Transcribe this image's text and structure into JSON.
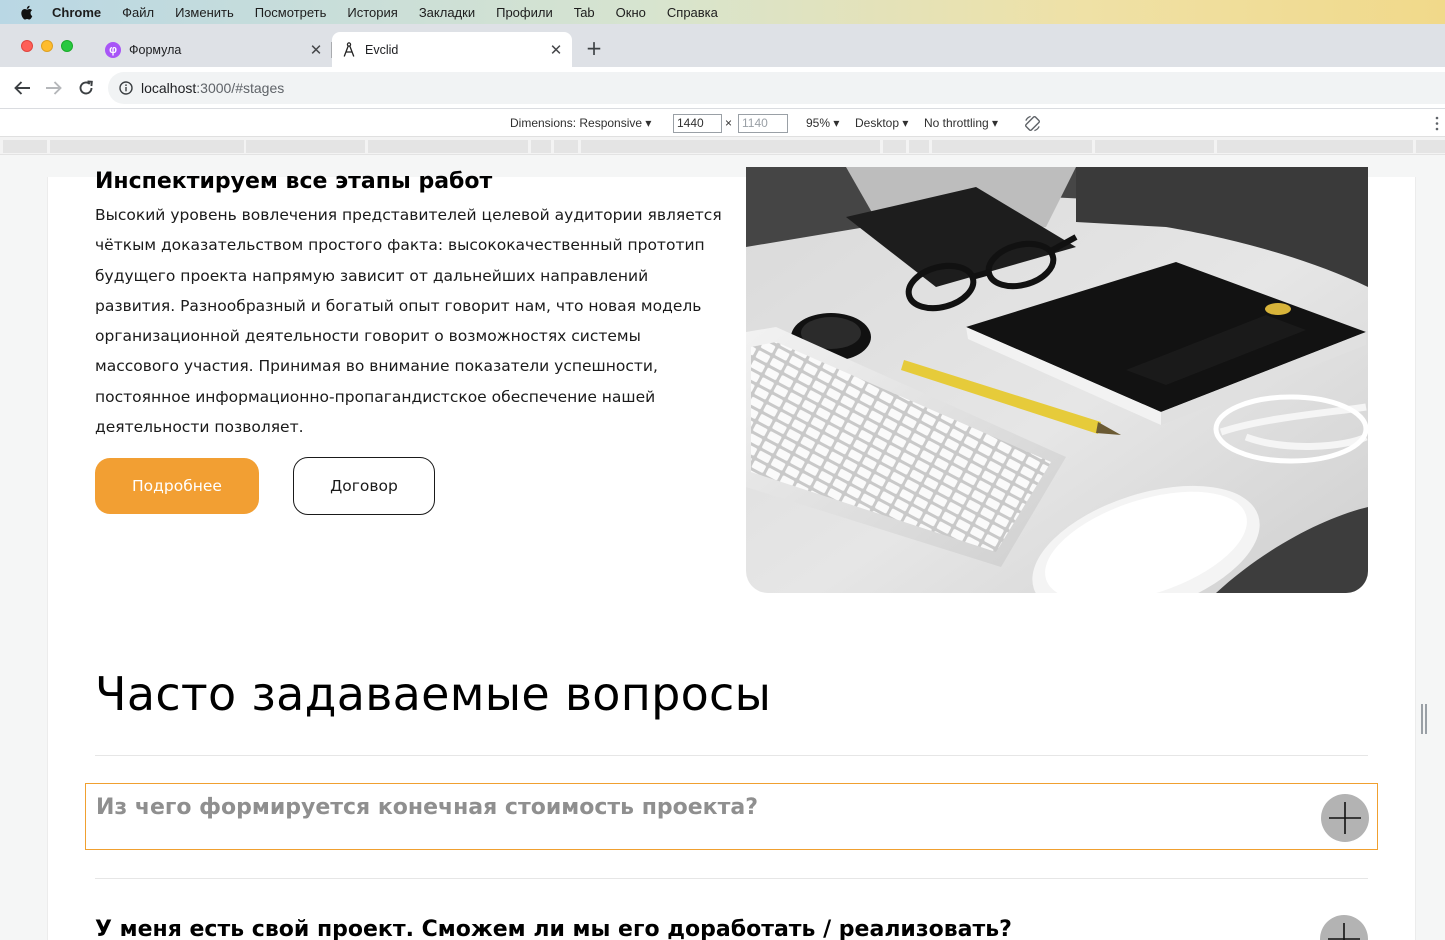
{
  "menubar": {
    "app_name": "Chrome",
    "items": [
      "Файл",
      "Изменить",
      "Посмотреть",
      "История",
      "Закладки",
      "Профили",
      "Tab",
      "Окно",
      "Справка"
    ]
  },
  "tabs": [
    {
      "title": "Формула",
      "favicon": "formula-favicon",
      "active": false,
      "favicon_glyph": "φ"
    },
    {
      "title": "Evclid",
      "favicon": "compass-favicon",
      "active": true
    }
  ],
  "toolbar": {
    "url_host": "localhost",
    "url_rest": ":3000/#stages"
  },
  "devtools": {
    "dimensions_label": "Dimensions: Responsive",
    "width_value": "1440",
    "height_placeholder": "1140",
    "times_symbol": "×",
    "zoom": "95%",
    "device_type": "Desktop",
    "throttling": "No throttling"
  },
  "stages_section": {
    "title": "Инспектируем все этапы работ",
    "text": "Высокий уровень вовлечения представителей целевой аудитории является чёткым доказательством простого факта: высококачественный прототип будущего проекта напрямую зависит от дальнейших направлений развития. Разнообразный и богатый опыт говорит нам, что новая модель организационной деятельности говорит о возможностях системы массового участия. Принимая во внимание показатели успешности, постоянное информационно-пропагандистское обеспечение нашей деятельности позволяет.",
    "primary_button": "Подробнее",
    "secondary_button": "Договор",
    "photo": "desk-photo-keyboard-notebook-glasses"
  },
  "faq": {
    "title": "Часто задаваемые вопросы",
    "items": [
      {
        "question": "Из чего формируется конечная стоимость проекта?",
        "state": "focused"
      },
      {
        "question": "У меня есть свой проект. Сможем ли мы его доработать / реализовать?",
        "state": "collapsed"
      }
    ]
  },
  "colors": {
    "accent": "#f29f33",
    "focus_outline": "#f0a030",
    "toggle": "#b3b3b3"
  }
}
